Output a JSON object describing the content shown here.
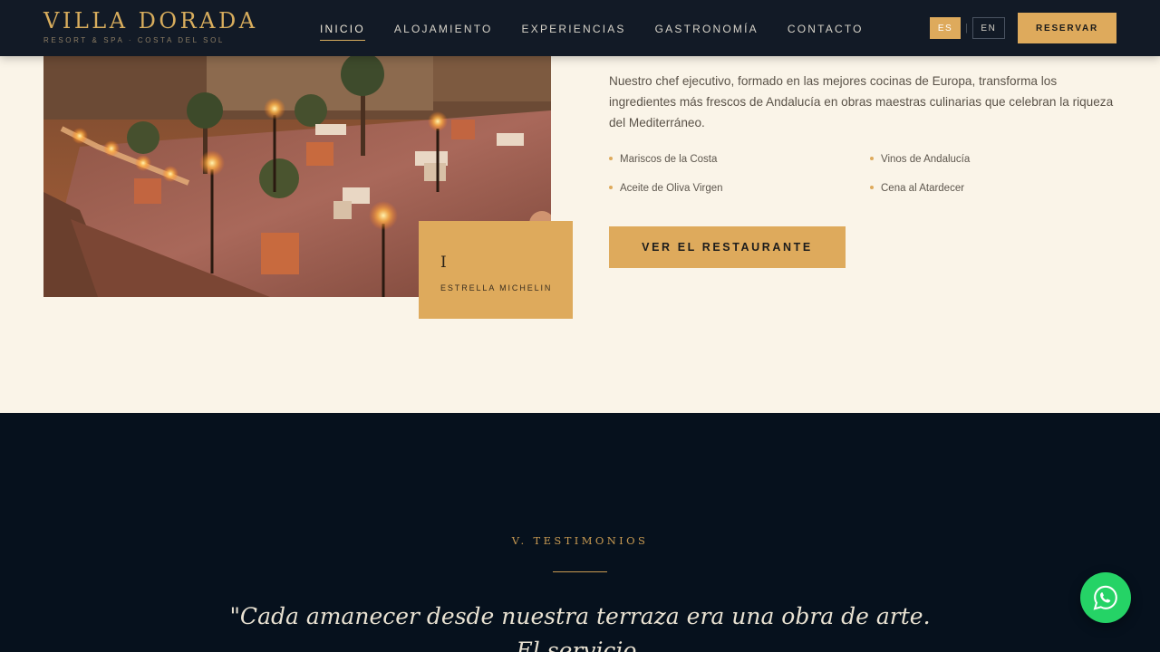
{
  "brand": {
    "name": "VILLA DORADA",
    "subtitle": "RESORT & SPA · COSTA DEL SOL"
  },
  "nav": {
    "items": [
      {
        "label": "INICIO",
        "active": true
      },
      {
        "label": "ALOJAMIENTO",
        "active": false
      },
      {
        "label": "EXPERIENCIAS",
        "active": false
      },
      {
        "label": "GASTRONOMÍA",
        "active": false
      },
      {
        "label": "CONTACTO",
        "active": false
      }
    ],
    "lang": {
      "es": "ES",
      "sep": "|",
      "en": "EN"
    },
    "reserve_label": "RESERVAR"
  },
  "restaurant": {
    "badge": {
      "number": "I",
      "label": "ESTRELLA MICHELIN"
    },
    "description": "Nuestro chef ejecutivo, formado en las mejores cocinas de Europa, transforma los ingredientes más frescos de Andalucía en obras maestras culinarias que celebran la riqueza del Mediterráneo.",
    "features": [
      "Mariscos de la Costa",
      "Vinos de Andalucía",
      "Aceite de Oliva Virgen",
      "Cena al Atardecer"
    ],
    "cta_label": "VER EL RESTAURANTE"
  },
  "testimonials": {
    "heading": "V. TESTIMONIOS",
    "quote": "\"Cada amanecer desde nuestra terraza era una obra de arte. El servicio,"
  },
  "whatsapp": {
    "icon": "whatsapp-icon",
    "color": "#25d366"
  },
  "colors": {
    "accent": "#deaa5c",
    "nav_bg": "#08111e",
    "cream": "#faf4e8",
    "dark_section": "#06111d"
  }
}
